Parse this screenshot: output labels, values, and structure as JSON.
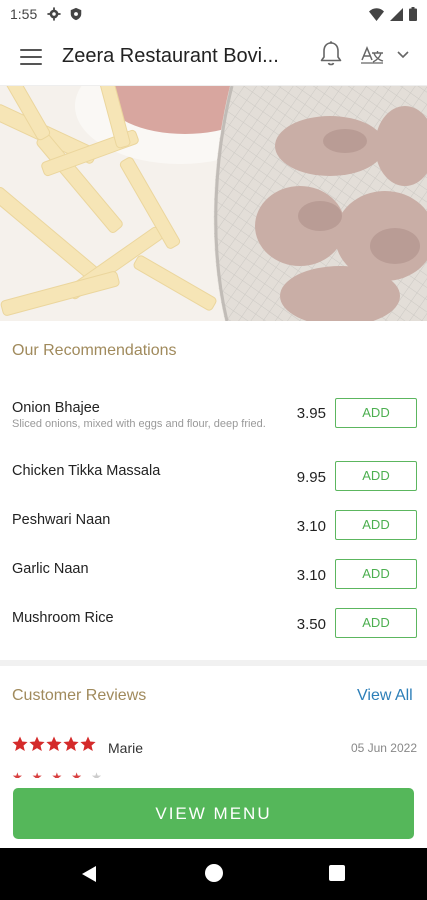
{
  "status_bar": {
    "time": "1:55",
    "icons": [
      "settings-gear-icon",
      "shield-icon",
      "wifi-icon",
      "signal-icon",
      "battery-icon"
    ]
  },
  "app_bar": {
    "title": "Zeera Restaurant Bovi...",
    "icons": [
      "hamburger-menu-icon",
      "bell-icon",
      "language-icon",
      "chevron-down-icon"
    ]
  },
  "hero": {
    "description_icon": "food-banner-image"
  },
  "recommendations": {
    "title": "Our Recommendations",
    "items": [
      {
        "name": "Onion Bhajee",
        "description": "Sliced onions, mixed with eggs and flour, deep fried.",
        "price": "3.95",
        "action": "ADD"
      },
      {
        "name": "Chicken Tikka Massala",
        "description": "",
        "price": "9.95",
        "action": "ADD"
      },
      {
        "name": "Peshwari Naan",
        "description": "",
        "price": "3.10",
        "action": "ADD"
      },
      {
        "name": "Garlic Naan",
        "description": "",
        "price": "3.10",
        "action": "ADD"
      },
      {
        "name": "Mushroom Rice",
        "description": "",
        "price": "3.50",
        "action": "ADD"
      }
    ]
  },
  "reviews": {
    "title": "Customer Reviews",
    "view_all": "View All",
    "entries": [
      {
        "rating": 5,
        "name": "Marie",
        "date": "05 Jun 2022"
      }
    ]
  },
  "cta": {
    "label": "VIEW MENU"
  },
  "colors": {
    "accent_green": "#55b75a",
    "section_gold": "#a08a5c",
    "link_blue": "#2d7fb8",
    "star_red": "#d42a2a"
  }
}
